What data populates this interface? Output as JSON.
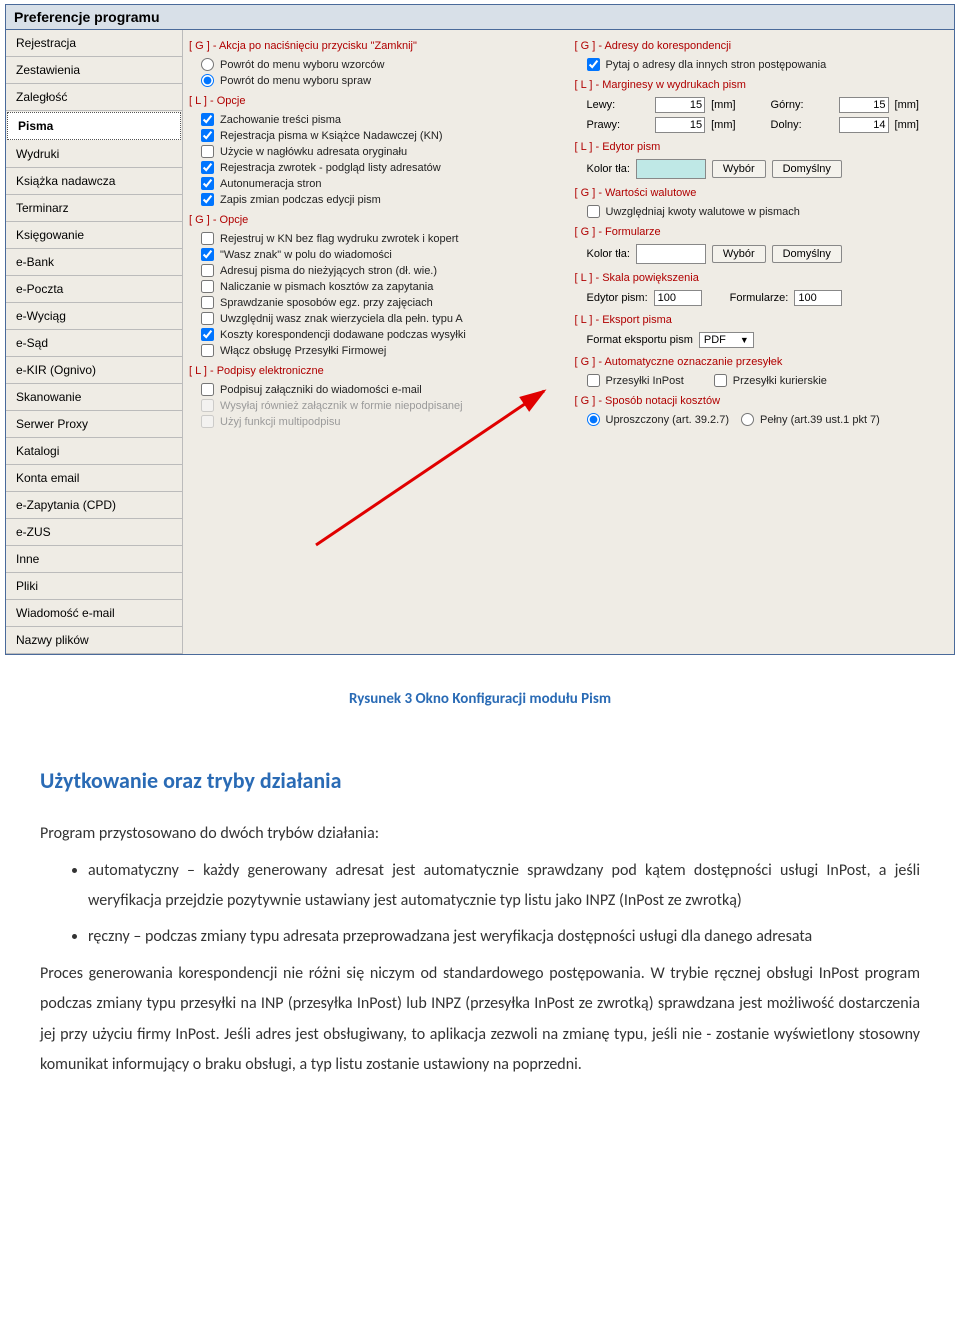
{
  "window": {
    "title": "Preferencje programu"
  },
  "sidebar": {
    "items": [
      {
        "label": "Rejestracja"
      },
      {
        "label": "Zestawienia"
      },
      {
        "label": "Zaległość"
      },
      {
        "label": "Pisma",
        "selected": true
      },
      {
        "label": "Wydruki"
      },
      {
        "label": "Książka nadawcza"
      },
      {
        "label": "Terminarz"
      },
      {
        "label": "Księgowanie"
      },
      {
        "label": "e-Bank"
      },
      {
        "label": "e-Poczta"
      },
      {
        "label": "e-Wyciąg"
      },
      {
        "label": "e-Sąd"
      },
      {
        "label": "e-KIR (Ognivo)"
      },
      {
        "label": "Skanowanie"
      },
      {
        "label": "Serwer Proxy"
      },
      {
        "label": "Katalogi"
      },
      {
        "label": "Konta email"
      },
      {
        "label": "e-Zapytania (CPD)"
      },
      {
        "label": "e-ZUS"
      },
      {
        "label": "Inne"
      },
      {
        "label": "Pliki"
      },
      {
        "label": "Wiadomość e-mail"
      },
      {
        "label": "Nazwy plików"
      }
    ]
  },
  "left": {
    "zamknij": {
      "title": "[ G ] - Akcja po naciśnięciu przycisku \"Zamknij\"",
      "r1": "Powrót do menu wyboru wzorców",
      "r2": "Powrót do menu wyboru spraw"
    },
    "opcje1": {
      "title": "[ L ] - Opcje",
      "c1": "Zachowanie treści pisma",
      "c2": "Rejestracja pisma w Książce Nadawczej (KN)",
      "c3": "Użycie w nagłówku adresata oryginału",
      "c4": "Rejestracja zwrotek - podgląd listy adresatów",
      "c5": "Autonumeracja stron",
      "c6": "Zapis zmian podczas edycji pism"
    },
    "opcje2": {
      "title": "[ G ] - Opcje",
      "c1": "Rejestruj w KN bez flag wydruku zwrotek i kopert",
      "c2": "\"Wasz znak\" w polu do wiadomości",
      "c3": "Adresuj pisma do nieżyjących stron (dł. wie.)",
      "c4": "Naliczanie w pismach kosztów za zapytania",
      "c5": "Sprawdzanie sposobów egz. przy zajęciach",
      "c6": "Uwzględnij wasz znak wierzyciela dla pełn. typu A",
      "c7": "Koszty korespondencji dodawane podczas wysyłki",
      "c8": "Włącz obsługę Przesyłki Firmowej"
    },
    "podpisy": {
      "title": "[ L ] - Podpisy elektroniczne",
      "c1": "Podpisuj załączniki do wiadomości e-mail",
      "c2": "Wysyłaj również załącznik w formie niepodpisanej",
      "c3": "Użyj funkcji multipodpisu"
    }
  },
  "right": {
    "adresy": {
      "title": "[ G ] - Adresy do korespondencji",
      "c1": "Pytaj o adresy dla innych stron postępowania"
    },
    "marginesy": {
      "title": "[ L ] - Marginesy w wydrukach pism",
      "lewy_lbl": "Lewy:",
      "lewy": "15",
      "gorny_lbl": "Górny:",
      "gorny": "15",
      "prawy_lbl": "Prawy:",
      "prawy": "15",
      "dolny_lbl": "Dolny:",
      "dolny": "14",
      "unit": "[mm]"
    },
    "edytor": {
      "title": "[ L ] - Edytor pism",
      "kolor_lbl": "Kolor tła:",
      "wybor": "Wybór",
      "domyslny": "Domyślny"
    },
    "walutowe": {
      "title": "[ G ] - Wartości walutowe",
      "c1": "Uwzględniaj kwoty walutowe w pismach"
    },
    "formularze": {
      "title": "[ G ] - Formularze",
      "kolor_lbl": "Kolor tła:",
      "wybor": "Wybór",
      "domyslny": "Domyślny"
    },
    "skala": {
      "title": "[ L ] - Skala powiększenia",
      "ed_lbl": "Edytor pism:",
      "ed": "100",
      "form_lbl": "Formularze:",
      "form": "100"
    },
    "eksport": {
      "title": "[ L ] - Eksport pisma",
      "lbl": "Format eksportu pism",
      "val": "PDF"
    },
    "auto": {
      "title": "[ G ] - Automatyczne oznaczanie przesyłek",
      "c1": "Przesyłki InPost",
      "c2": "Przesyłki kurierskie"
    },
    "notacja": {
      "title": "[ G ] - Sposób notacji kosztów",
      "r1": "Uproszczony (art. 39.2.7)",
      "r2": "Pełny (art.39 ust.1 pkt 7)"
    }
  },
  "doc": {
    "caption": "Rysunek 3 Okno Konfiguracji modułu Pism",
    "h2": "Użytkowanie oraz tryby działania",
    "p1": "Program przystosowano do dwóch trybów działania:",
    "li1": "automatyczny – każdy generowany adresat jest automatycznie sprawdzany pod kątem dostępności usługi InPost, a jeśli weryfikacja przejdzie pozytywnie ustawiany jest automatycznie typ listu jako INPZ (InPost ze zwrotką)",
    "li2": "ręczny – podczas zmiany typu adresata przeprowadzana jest weryfikacja dostępności usługi dla danego adresata",
    "p2": "Proces generowania korespondencji nie różni się niczym od standardowego postępowania. W trybie ręcznej obsługi InPost program podczas zmiany typu przesyłki na INP (przesyłka InPost) lub INPZ (przesyłka InPost ze zwrotką) sprawdzana jest możliwość dostarczenia jej przy użyciu firmy InPost. Jeśli adres jest obsługiwany, to aplikacja zezwoli na zmianę typu, jeśli nie - zostanie wyświetlony stosowny komunikat informujący o braku obsługi, a typ listu zostanie ustawiony na poprzedni."
  }
}
